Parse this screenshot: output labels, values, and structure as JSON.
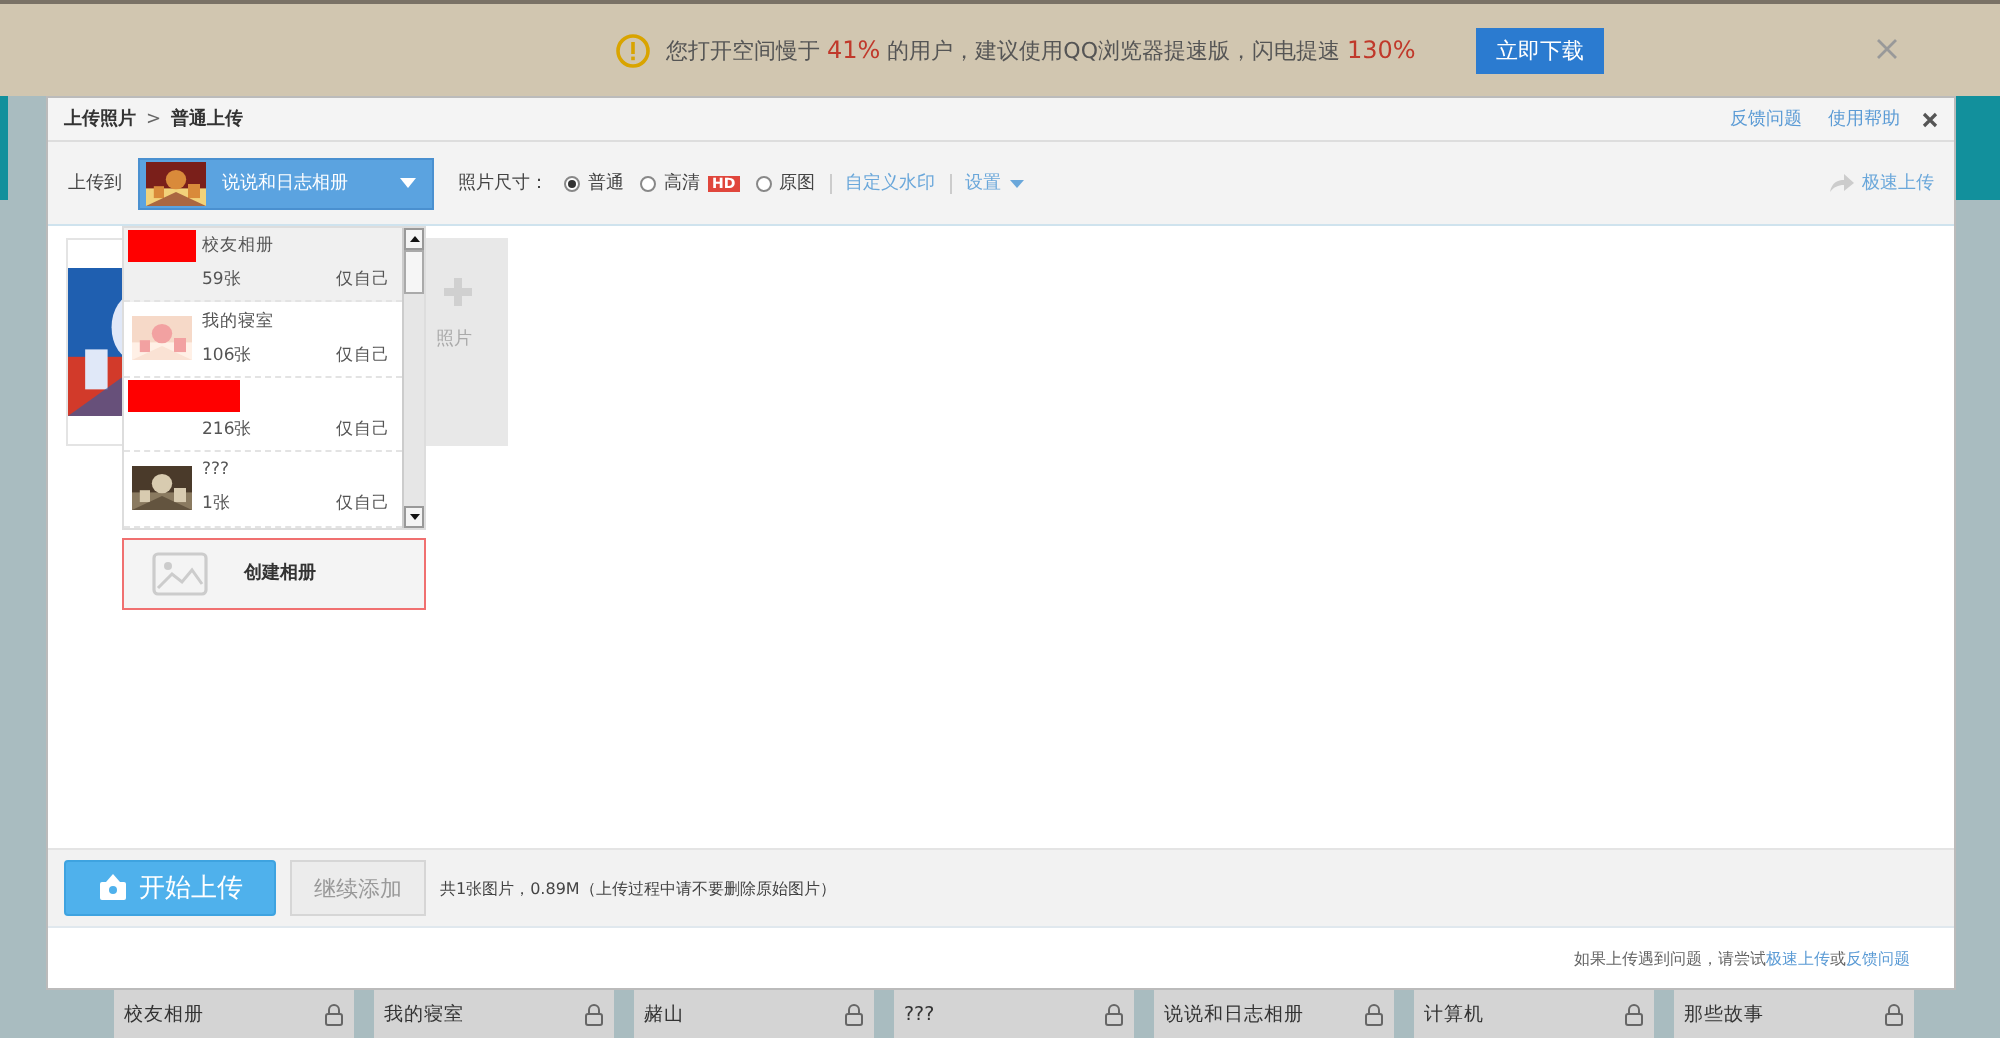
{
  "notice": {
    "parts": [
      {
        "text": "您打开空间慢于 ",
        "highlight": false
      },
      {
        "text": "41%",
        "highlight": true
      },
      {
        "text": " 的用户，建议使用QQ浏览器提速版，闪电提速 ",
        "highlight": false
      },
      {
        "text": "130%",
        "highlight": true
      }
    ],
    "button": "立即下载"
  },
  "dialog": {
    "breadcrumb": [
      "上传照片",
      "普通上传"
    ],
    "separator": ">",
    "links": [
      "反馈问题",
      "使用帮助"
    ],
    "upload_to": {
      "label": "上传到",
      "album": "说说和日志相册",
      "expanded": true
    },
    "size": {
      "label": "照片尺寸：",
      "options": [
        {
          "label": "普通",
          "selected": true
        },
        {
          "label": "高清",
          "selected": false,
          "badge": "HD"
        },
        {
          "label": "原图",
          "selected": false
        }
      ]
    },
    "toolbar_links": [
      "自定义水印",
      "设置"
    ],
    "fast_upload": "极速上传",
    "albums": [
      {
        "name": "校友相册",
        "count": "59张",
        "privacy": "仅自己",
        "redacted": true,
        "selected": true
      },
      {
        "name": "我的寝室",
        "count": "106张",
        "privacy": "仅自己",
        "redacted": false,
        "selected": false
      },
      {
        "count": "216张",
        "privacy": "仅自己",
        "redacted": true,
        "selected": false
      },
      {
        "name": "???",
        "count": "1张",
        "privacy": "仅自己",
        "redacted": false,
        "selected": false
      }
    ],
    "create_album": "创建相册",
    "add_photo": "照片",
    "start_button": "开始上传",
    "continue_button": "继续添加",
    "summary": "共1张图片，0.89M（上传过程中请不要删除原始图片）",
    "note": {
      "text": "如果上传遇到问题，请尝试",
      "link": "极速上传",
      "joiner": "或",
      "link2": "反馈问题"
    }
  },
  "album_bar": [
    "校友相册",
    "我的寝室",
    "赭山",
    "???",
    "说说和日志相册",
    "计算机",
    "那些故事"
  ]
}
